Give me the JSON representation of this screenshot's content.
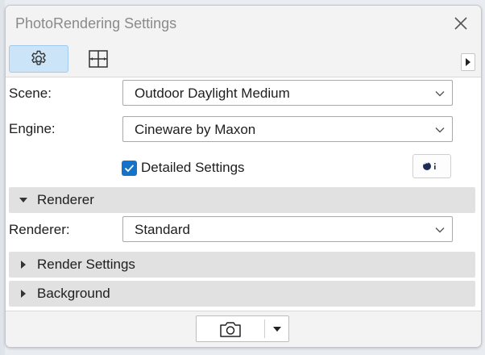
{
  "window": {
    "title": "PhotoRendering Settings"
  },
  "toolbar": {
    "tabs": [
      {
        "icon": "gear-icon",
        "active": true
      },
      {
        "icon": "layout-frame-icon",
        "active": false
      }
    ]
  },
  "scene": {
    "label": "Scene:",
    "value": "Outdoor Daylight Medium"
  },
  "engine": {
    "label": "Engine:",
    "value": "Cineware by Maxon"
  },
  "detailed_settings": {
    "label": "Detailed Settings",
    "checked": true
  },
  "sections": {
    "renderer": {
      "label": "Renderer",
      "expanded": true
    },
    "render_settings": {
      "label": "Render Settings",
      "expanded": false
    },
    "background": {
      "label": "Background",
      "expanded": false
    }
  },
  "renderer": {
    "label": "Renderer:",
    "value": "Standard"
  },
  "colors": {
    "accent": "#1473c8",
    "active_tab": "#cce4f7",
    "section_header": "#e1e1e1"
  }
}
